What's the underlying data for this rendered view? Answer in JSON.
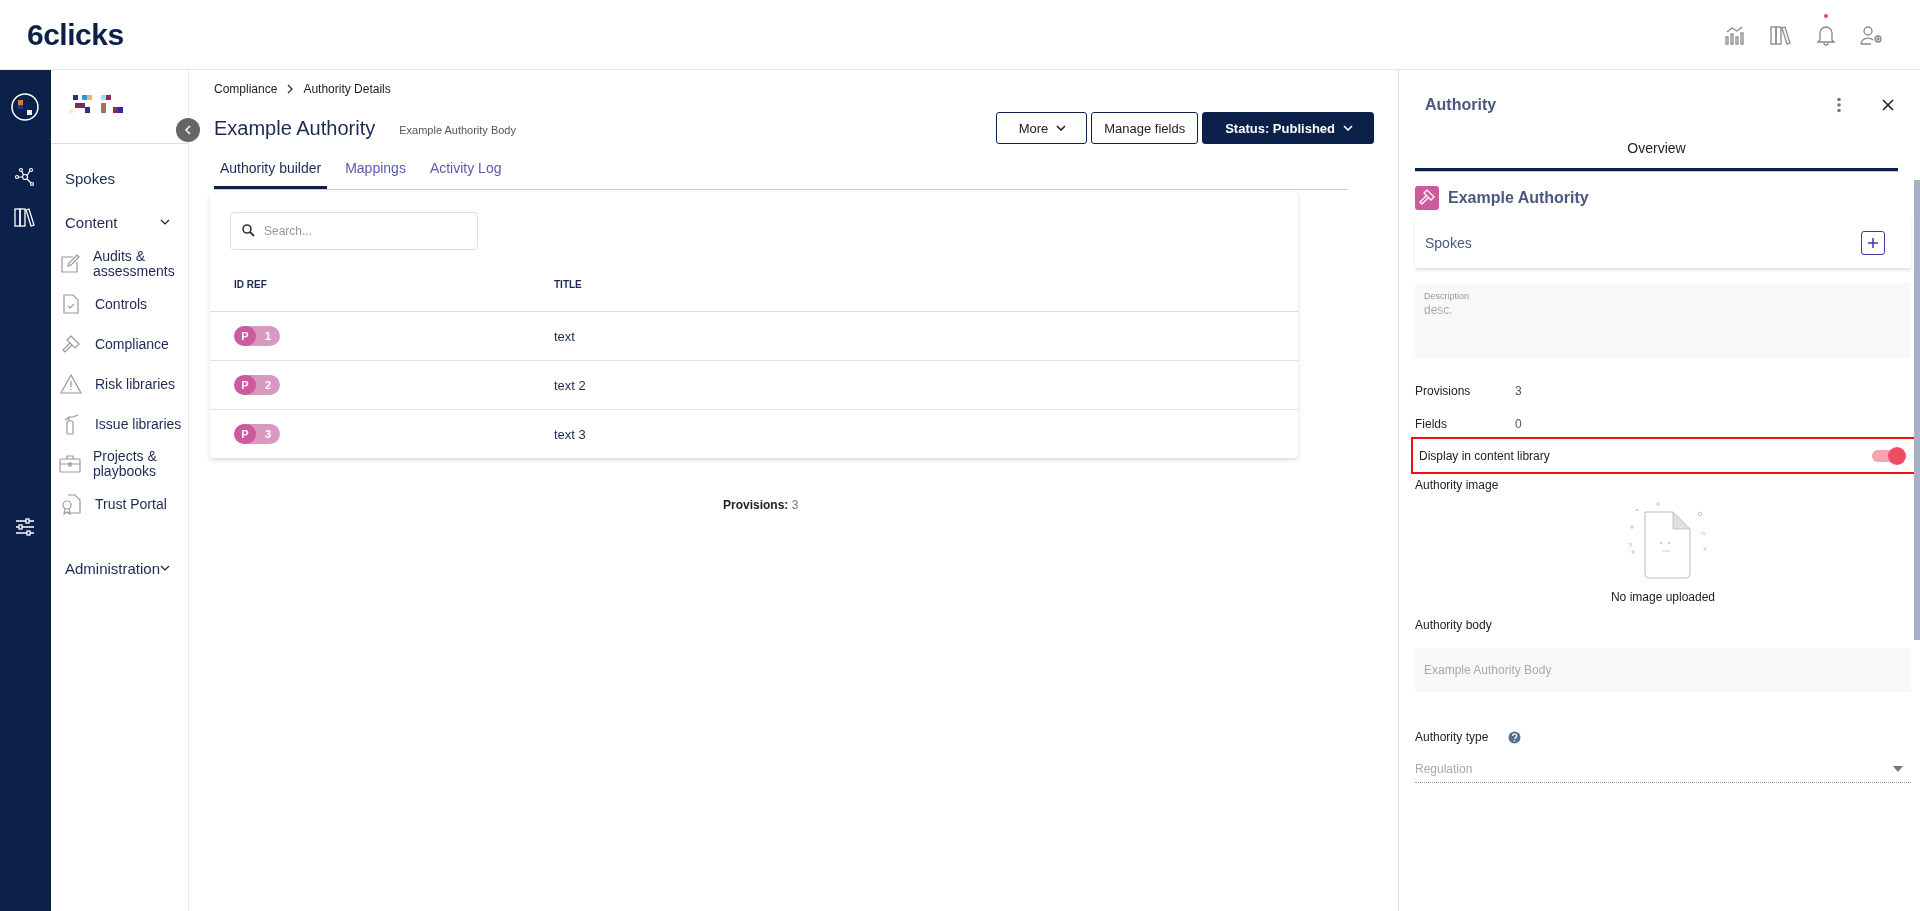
{
  "header": {
    "logo": "6clicks",
    "notification_dot": true
  },
  "sidebar": {
    "items": [
      {
        "kind": "link",
        "label": "Spokes"
      },
      {
        "kind": "group",
        "label": "Content"
      },
      {
        "kind": "item",
        "label": "Audits & assessments"
      },
      {
        "kind": "item",
        "label": "Controls"
      },
      {
        "kind": "item",
        "label": "Compliance"
      },
      {
        "kind": "item",
        "label": "Risk libraries"
      },
      {
        "kind": "item",
        "label": "Issue libraries"
      },
      {
        "kind": "item",
        "label": "Projects & playbooks"
      },
      {
        "kind": "item",
        "label": "Trust Portal"
      },
      {
        "kind": "group",
        "label": "Administration"
      }
    ]
  },
  "breadcrumb": [
    "Compliance",
    "Authority Details"
  ],
  "title": "Example Authority",
  "subtitle": "Example Authority Body",
  "buttons": [
    {
      "kind": "outline",
      "label": "More",
      "caret": true
    },
    {
      "kind": "outline",
      "label": "Manage fields",
      "caret": false
    },
    {
      "kind": "primary",
      "label": "Status: Published",
      "caret": true
    }
  ],
  "tabs": [
    {
      "label": "Authority builder",
      "selected": true
    },
    {
      "label": "Mappings",
      "selected": false
    },
    {
      "label": "Activity Log",
      "selected": false
    }
  ],
  "search": {
    "placeholder": "Search..."
  },
  "table": {
    "columns": [
      "ID REF",
      "TITLE"
    ],
    "rows": [
      {
        "prefix": "P",
        "number": "1",
        "title": "text"
      },
      {
        "prefix": "P",
        "number": "2",
        "title": "text 2"
      },
      {
        "prefix": "P",
        "number": "3",
        "title": "text 3"
      }
    ]
  },
  "footer": {
    "label": "Provisions:",
    "value": "3"
  },
  "panel": {
    "title": "Authority",
    "tabs": [
      {
        "label": "Overview",
        "selected": true
      }
    ],
    "heading": "Example Authority",
    "spokes_label": "Spokes",
    "description": {
      "label": "Description",
      "value": "desc."
    },
    "stats": [
      {
        "label": "Provisions",
        "value": "3"
      },
      {
        "label": "Fields",
        "value": "0"
      }
    ],
    "toggle": {
      "label": "Display in content library",
      "on": true,
      "highlighted": true
    },
    "image": {
      "label": "Authority image",
      "empty_text": "No image uploaded"
    },
    "body": {
      "label": "Authority body",
      "value": "Example Authority Body"
    },
    "type": {
      "label": "Authority type",
      "value": "Regulation"
    }
  }
}
